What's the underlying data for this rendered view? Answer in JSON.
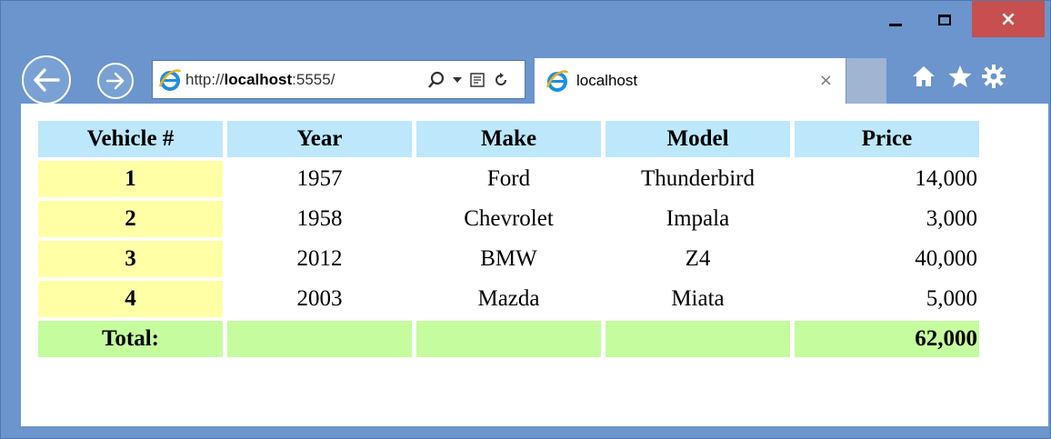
{
  "window": {
    "caption_buttons": {
      "minimize": "–",
      "maximize": "□",
      "close": "×"
    }
  },
  "browser": {
    "address": {
      "url_prefix": "http://",
      "url_host": "localhost",
      "url_rest": ":5555/"
    },
    "tab": {
      "title": "localhost",
      "close": "×"
    },
    "icons": [
      "back-arrow-icon",
      "forward-arrow-icon",
      "ie-logo-icon",
      "search-icon",
      "dropdown-icon",
      "compatibility-icon",
      "refresh-icon",
      "home-icon",
      "star-icon",
      "gear-icon"
    ]
  },
  "colors": {
    "frame": "#6b95cc",
    "close_button": "#c74f4f",
    "header_cell": "#bde7fb",
    "number_cell": "#ffffa6",
    "total_row": "#c5fc9e"
  },
  "table": {
    "headers": [
      "Vehicle #",
      "Year",
      "Make",
      "Model",
      "Price"
    ],
    "rows": [
      {
        "num": "1",
        "year": "1957",
        "make": "Ford",
        "model": "Thunderbird",
        "price": "14,000"
      },
      {
        "num": "2",
        "year": "1958",
        "make": "Chevrolet",
        "model": "Impala",
        "price": "3,000"
      },
      {
        "num": "3",
        "year": "2012",
        "make": "BMW",
        "model": "Z4",
        "price": "40,000"
      },
      {
        "num": "4",
        "year": "2003",
        "make": "Mazda",
        "model": "Miata",
        "price": "5,000"
      }
    ],
    "total": {
      "label": "Total:",
      "price": "62,000"
    }
  }
}
